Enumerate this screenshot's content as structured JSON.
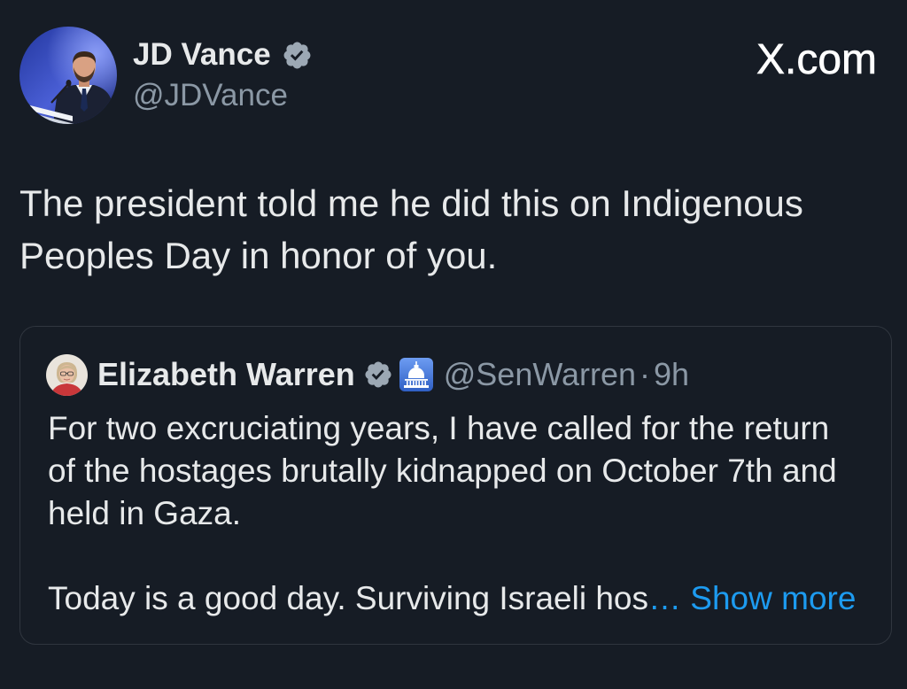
{
  "theme": {
    "background": "#161c25",
    "text": "#e7e9ea",
    "secondary": "#8b98a5",
    "link": "#1d9bf0",
    "border": "#30363f",
    "badge": "#9ca8b4"
  },
  "brand": {
    "domain": "X.com"
  },
  "author": {
    "name": "JD Vance",
    "handle": "@JDVance",
    "avatar_icon": "avatar-photo",
    "badge_icon": "verified-badge-icon"
  },
  "post": {
    "text_lines": [
      "The president told me he did this on Indigenous",
      "Peoples Day in honor of you."
    ]
  },
  "quoted_post": {
    "author": {
      "name": "Elizabeth Warren",
      "handle": "@SenWarren",
      "avatar_icon": "avatar-photo",
      "badge_icon": "verified-badge-icon",
      "affiliation_icon": "us-capitol-icon"
    },
    "separator": "·",
    "time": "9h",
    "body_lines": [
      "For two excruciating years, I have called for the return",
      "of the hostages brutally kidnapped on October 7th and",
      "held in Gaza."
    ],
    "last_line": {
      "text": "Today is a good day. Surviving Israeli hos",
      "ellipsis": "…",
      "show_more": "Show more"
    }
  }
}
